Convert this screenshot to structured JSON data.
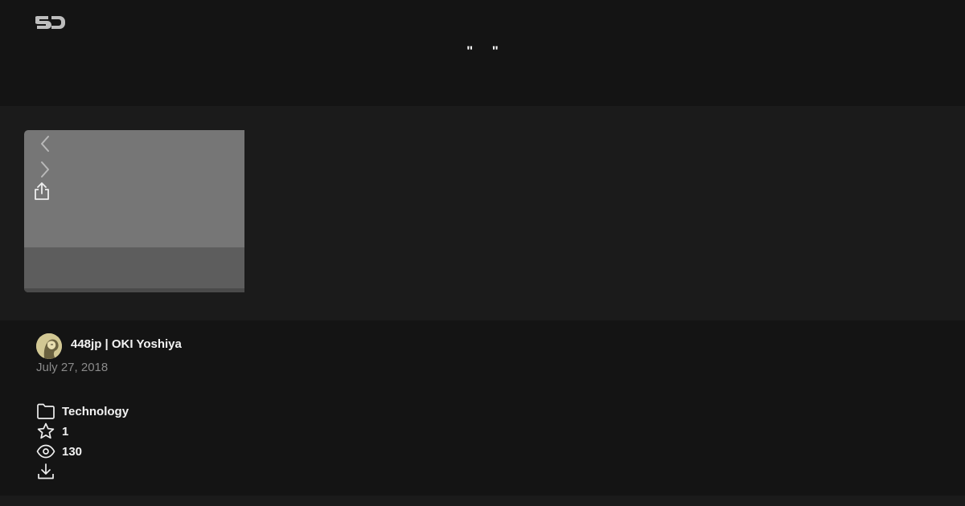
{
  "header": {
    "logo_icon": "speakerdeck-logo-icon",
    "title": "\"     \""
  },
  "slide_viewer": {
    "prev_icon": "chevron-left-icon",
    "next_icon": "chevron-right-icon",
    "share_icon": "share-icon"
  },
  "presentation": {
    "author": "448jp | OKI Yoshiya",
    "date": "July 27, 2018",
    "category": "Technology",
    "stars": "1",
    "views": "130"
  },
  "colors": {
    "background": "#141414",
    "stage": "#1b1b1b",
    "slide": "#767676",
    "muted_text": "#8a8a8a"
  }
}
